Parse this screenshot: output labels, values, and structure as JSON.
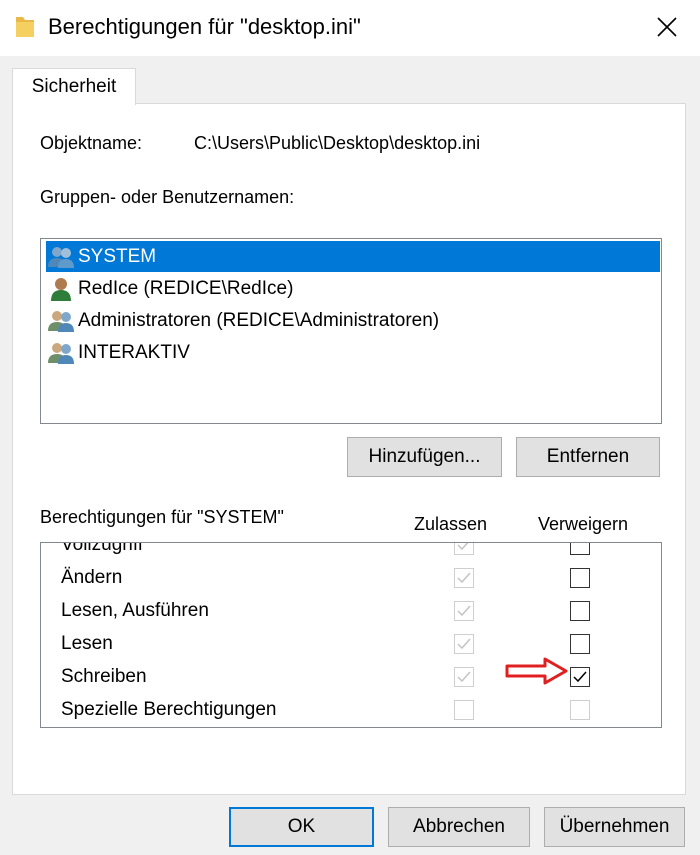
{
  "window": {
    "title": "Berechtigungen für \"desktop.ini\"",
    "icon": "folder-icon",
    "close_icon": "close-icon"
  },
  "tabs": [
    {
      "label": "Sicherheit",
      "active": true
    }
  ],
  "object": {
    "label": "Objektname:",
    "value": "C:\\Users\\Public\\Desktop\\desktop.ini"
  },
  "groups": {
    "label": "Gruppen- oder Benutzernamen:",
    "items": [
      {
        "label": "SYSTEM",
        "icon": "group-icon",
        "selected": true
      },
      {
        "label": "RedIce (REDICE\\RedIce)",
        "icon": "user-icon",
        "selected": false
      },
      {
        "label": "Administratoren (REDICE\\Administratoren)",
        "icon": "group-icon",
        "selected": false
      },
      {
        "label": "INTERAKTIV",
        "icon": "group-icon",
        "selected": false
      }
    ]
  },
  "buttons": {
    "add": "Hinzufügen...",
    "remove": "Entfernen"
  },
  "permissions": {
    "label": "Berechtigungen für \"SYSTEM\"",
    "allow_header": "Zulassen",
    "deny_header": "Verweigern",
    "rows": [
      {
        "name": "Vollzugriff",
        "allow": true,
        "allow_disabled": true,
        "deny": false,
        "deny_disabled": false
      },
      {
        "name": "Ändern",
        "allow": true,
        "allow_disabled": true,
        "deny": false,
        "deny_disabled": false
      },
      {
        "name": "Lesen, Ausführen",
        "allow": true,
        "allow_disabled": true,
        "deny": false,
        "deny_disabled": false
      },
      {
        "name": "Lesen",
        "allow": true,
        "allow_disabled": true,
        "deny": false,
        "deny_disabled": false
      },
      {
        "name": "Schreiben",
        "allow": true,
        "allow_disabled": true,
        "deny": true,
        "deny_disabled": false
      },
      {
        "name": "Spezielle Berechtigungen",
        "allow": false,
        "allow_disabled": true,
        "deny": false,
        "deny_disabled": true
      }
    ]
  },
  "annotation": {
    "icon": "red-arrow-icon",
    "color": "#e02020"
  },
  "footer": {
    "ok": "OK",
    "cancel": "Abbrechen",
    "apply": "Übernehmen"
  },
  "colors": {
    "selection": "#0078d7",
    "default_button_border": "#0078d7"
  }
}
